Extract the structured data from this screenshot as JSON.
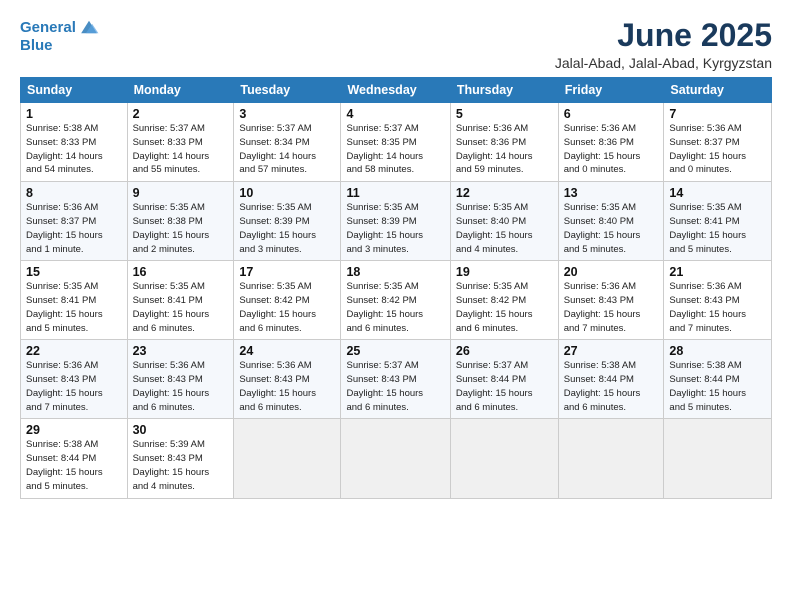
{
  "header": {
    "logo_line1": "General",
    "logo_line2": "Blue",
    "month": "June 2025",
    "location": "Jalal-Abad, Jalal-Abad, Kyrgyzstan"
  },
  "weekdays": [
    "Sunday",
    "Monday",
    "Tuesday",
    "Wednesday",
    "Thursday",
    "Friday",
    "Saturday"
  ],
  "weeks": [
    [
      {
        "day": "1",
        "detail": "Sunrise: 5:38 AM\nSunset: 8:33 PM\nDaylight: 14 hours\nand 54 minutes."
      },
      {
        "day": "2",
        "detail": "Sunrise: 5:37 AM\nSunset: 8:33 PM\nDaylight: 14 hours\nand 55 minutes."
      },
      {
        "day": "3",
        "detail": "Sunrise: 5:37 AM\nSunset: 8:34 PM\nDaylight: 14 hours\nand 57 minutes."
      },
      {
        "day": "4",
        "detail": "Sunrise: 5:37 AM\nSunset: 8:35 PM\nDaylight: 14 hours\nand 58 minutes."
      },
      {
        "day": "5",
        "detail": "Sunrise: 5:36 AM\nSunset: 8:36 PM\nDaylight: 14 hours\nand 59 minutes."
      },
      {
        "day": "6",
        "detail": "Sunrise: 5:36 AM\nSunset: 8:36 PM\nDaylight: 15 hours\nand 0 minutes."
      },
      {
        "day": "7",
        "detail": "Sunrise: 5:36 AM\nSunset: 8:37 PM\nDaylight: 15 hours\nand 0 minutes."
      }
    ],
    [
      {
        "day": "8",
        "detail": "Sunrise: 5:36 AM\nSunset: 8:37 PM\nDaylight: 15 hours\nand 1 minute."
      },
      {
        "day": "9",
        "detail": "Sunrise: 5:35 AM\nSunset: 8:38 PM\nDaylight: 15 hours\nand 2 minutes."
      },
      {
        "day": "10",
        "detail": "Sunrise: 5:35 AM\nSunset: 8:39 PM\nDaylight: 15 hours\nand 3 minutes."
      },
      {
        "day": "11",
        "detail": "Sunrise: 5:35 AM\nSunset: 8:39 PM\nDaylight: 15 hours\nand 3 minutes."
      },
      {
        "day": "12",
        "detail": "Sunrise: 5:35 AM\nSunset: 8:40 PM\nDaylight: 15 hours\nand 4 minutes."
      },
      {
        "day": "13",
        "detail": "Sunrise: 5:35 AM\nSunset: 8:40 PM\nDaylight: 15 hours\nand 5 minutes."
      },
      {
        "day": "14",
        "detail": "Sunrise: 5:35 AM\nSunset: 8:41 PM\nDaylight: 15 hours\nand 5 minutes."
      }
    ],
    [
      {
        "day": "15",
        "detail": "Sunrise: 5:35 AM\nSunset: 8:41 PM\nDaylight: 15 hours\nand 5 minutes."
      },
      {
        "day": "16",
        "detail": "Sunrise: 5:35 AM\nSunset: 8:41 PM\nDaylight: 15 hours\nand 6 minutes."
      },
      {
        "day": "17",
        "detail": "Sunrise: 5:35 AM\nSunset: 8:42 PM\nDaylight: 15 hours\nand 6 minutes."
      },
      {
        "day": "18",
        "detail": "Sunrise: 5:35 AM\nSunset: 8:42 PM\nDaylight: 15 hours\nand 6 minutes."
      },
      {
        "day": "19",
        "detail": "Sunrise: 5:35 AM\nSunset: 8:42 PM\nDaylight: 15 hours\nand 6 minutes."
      },
      {
        "day": "20",
        "detail": "Sunrise: 5:36 AM\nSunset: 8:43 PM\nDaylight: 15 hours\nand 7 minutes."
      },
      {
        "day": "21",
        "detail": "Sunrise: 5:36 AM\nSunset: 8:43 PM\nDaylight: 15 hours\nand 7 minutes."
      }
    ],
    [
      {
        "day": "22",
        "detail": "Sunrise: 5:36 AM\nSunset: 8:43 PM\nDaylight: 15 hours\nand 7 minutes."
      },
      {
        "day": "23",
        "detail": "Sunrise: 5:36 AM\nSunset: 8:43 PM\nDaylight: 15 hours\nand 6 minutes."
      },
      {
        "day": "24",
        "detail": "Sunrise: 5:36 AM\nSunset: 8:43 PM\nDaylight: 15 hours\nand 6 minutes."
      },
      {
        "day": "25",
        "detail": "Sunrise: 5:37 AM\nSunset: 8:43 PM\nDaylight: 15 hours\nand 6 minutes."
      },
      {
        "day": "26",
        "detail": "Sunrise: 5:37 AM\nSunset: 8:44 PM\nDaylight: 15 hours\nand 6 minutes."
      },
      {
        "day": "27",
        "detail": "Sunrise: 5:38 AM\nSunset: 8:44 PM\nDaylight: 15 hours\nand 6 minutes."
      },
      {
        "day": "28",
        "detail": "Sunrise: 5:38 AM\nSunset: 8:44 PM\nDaylight: 15 hours\nand 5 minutes."
      }
    ],
    [
      {
        "day": "29",
        "detail": "Sunrise: 5:38 AM\nSunset: 8:44 PM\nDaylight: 15 hours\nand 5 minutes."
      },
      {
        "day": "30",
        "detail": "Sunrise: 5:39 AM\nSunset: 8:43 PM\nDaylight: 15 hours\nand 4 minutes."
      },
      {
        "day": "",
        "detail": ""
      },
      {
        "day": "",
        "detail": ""
      },
      {
        "day": "",
        "detail": ""
      },
      {
        "day": "",
        "detail": ""
      },
      {
        "day": "",
        "detail": ""
      }
    ]
  ]
}
